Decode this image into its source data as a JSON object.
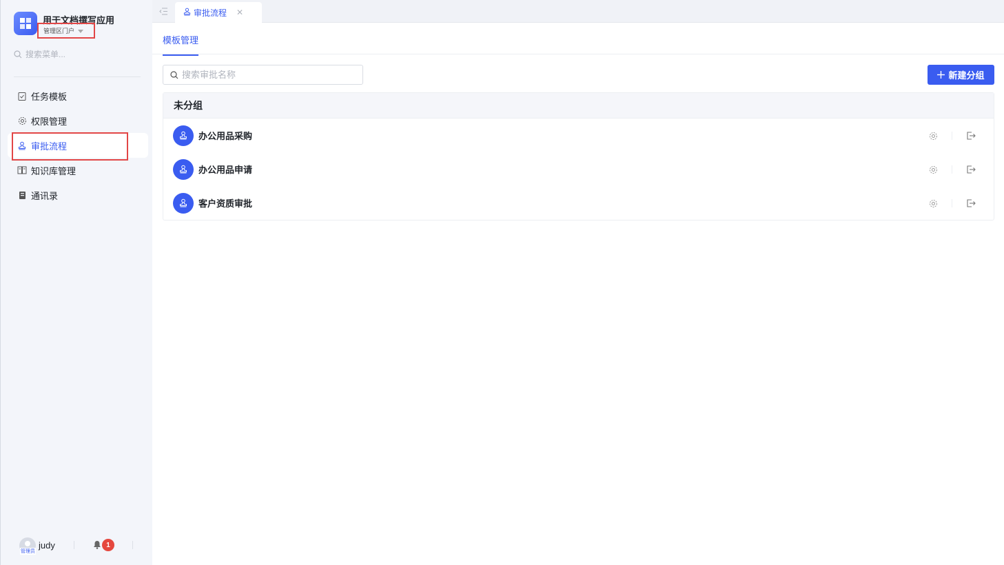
{
  "app": {
    "name": "用于文档撰写应用",
    "portal": "管理区门户"
  },
  "sidebar": {
    "search_placeholder": "搜索菜单...",
    "items": [
      {
        "label": "任务模板",
        "icon": "clipboard-check-icon",
        "active": false
      },
      {
        "label": "权限管理",
        "icon": "gear-icon",
        "active": false
      },
      {
        "label": "审批流程",
        "icon": "stamp-icon",
        "active": true
      },
      {
        "label": "知识库管理",
        "icon": "book-icon",
        "active": false
      },
      {
        "label": "通讯录",
        "icon": "contacts-icon",
        "active": false
      }
    ],
    "footer": {
      "username": "judy",
      "avatar_badge": "管理员",
      "notification_count": "1"
    }
  },
  "topbar": {
    "tab_label": "审批流程",
    "tab_close": "✕"
  },
  "main": {
    "subtab_label": "模板管理",
    "search_placeholder": "搜索审批名称",
    "new_group_button": "新建分组",
    "group": {
      "title": "未分组",
      "rows": [
        {
          "title": "办公用品采购"
        },
        {
          "title": "办公用品申请"
        },
        {
          "title": "客户资质审批"
        }
      ]
    }
  },
  "colors": {
    "accent": "#3a5cf0",
    "danger": "#e5483f",
    "highlight_box": "#e24646"
  }
}
